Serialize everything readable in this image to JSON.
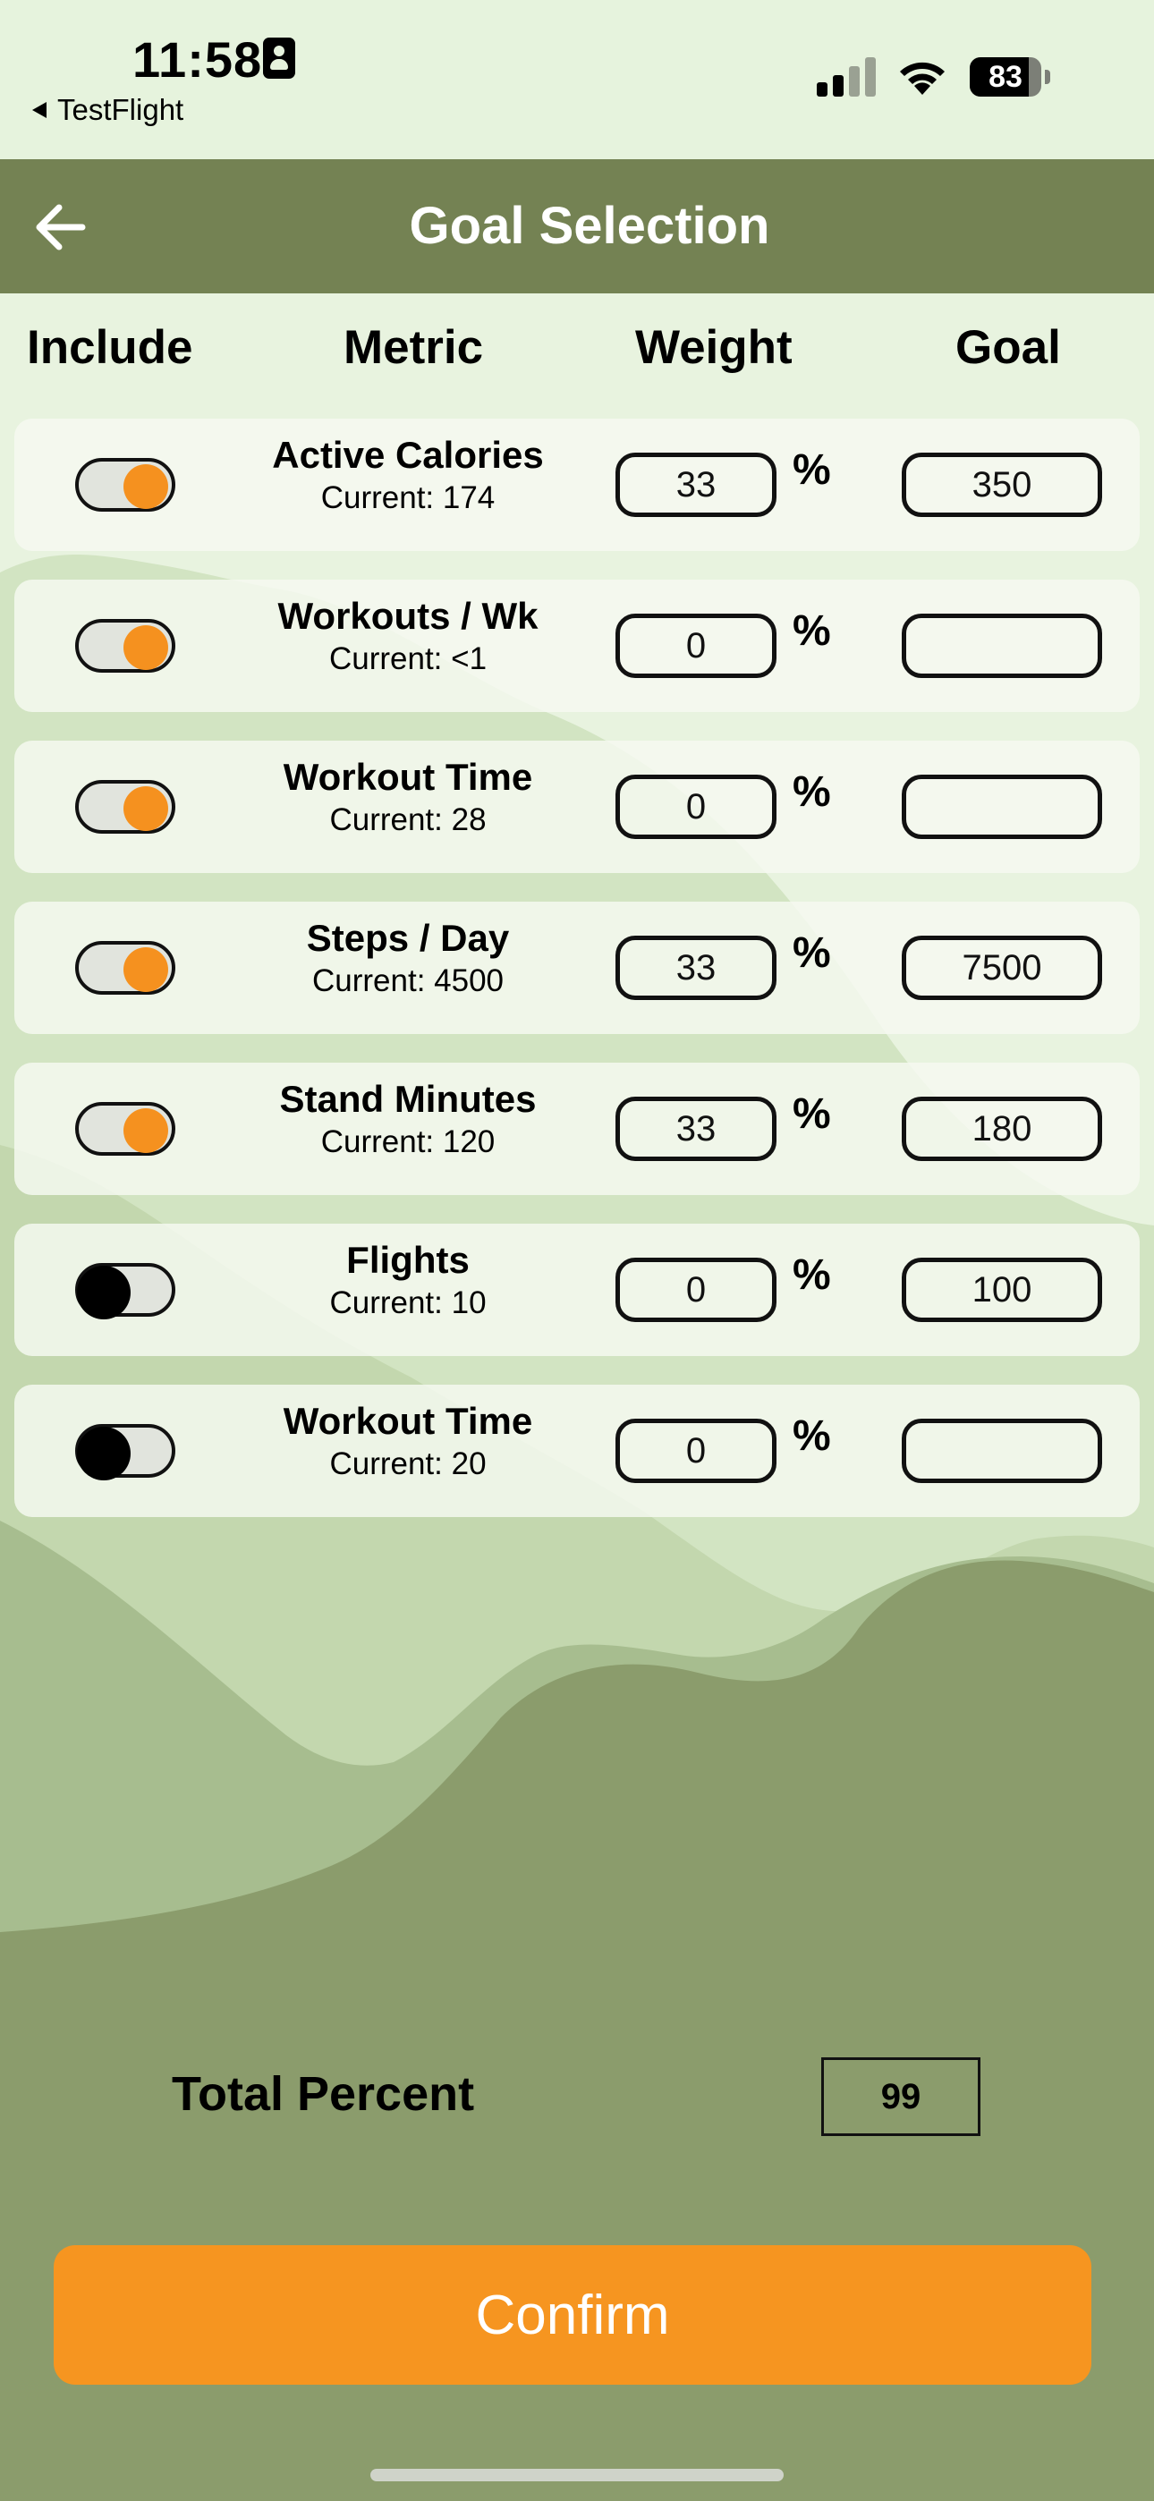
{
  "status_bar": {
    "time": "11:58",
    "back_app": "TestFlight",
    "battery": "83",
    "battery_level": 0.83
  },
  "nav": {
    "title": "Goal Selection"
  },
  "columns": {
    "include": "Include",
    "metric": "Metric",
    "weight": "Weight",
    "goal": "Goal"
  },
  "rows": [
    {
      "name": "Active Calories",
      "current": "Current: 174",
      "included": true,
      "weight": "33",
      "goal": "350"
    },
    {
      "name": "Workouts / Wk",
      "current": "Current: <1",
      "included": true,
      "weight": "0",
      "goal": ""
    },
    {
      "name": "Workout Time",
      "current": "Current: 28",
      "included": true,
      "weight": "0",
      "goal": ""
    },
    {
      "name": "Steps / Day",
      "current": "Current: 4500",
      "included": true,
      "weight": "33",
      "goal": "7500"
    },
    {
      "name": "Stand Minutes",
      "current": "Current: 120",
      "included": true,
      "weight": "33",
      "goal": "180"
    },
    {
      "name": "Flights",
      "current": "Current: 10",
      "included": false,
      "weight": "0",
      "goal": "100"
    },
    {
      "name": "Workout Time",
      "current": "Current: 20",
      "included": false,
      "weight": "0",
      "goal": ""
    }
  ],
  "percent_sign": "%",
  "total": {
    "label": "Total Percent",
    "value": "99"
  },
  "confirm_label": "Confirm",
  "colors": {
    "accent": "#f69520",
    "nav_bar": "#748253",
    "status_bar": "#e6f3dd"
  }
}
